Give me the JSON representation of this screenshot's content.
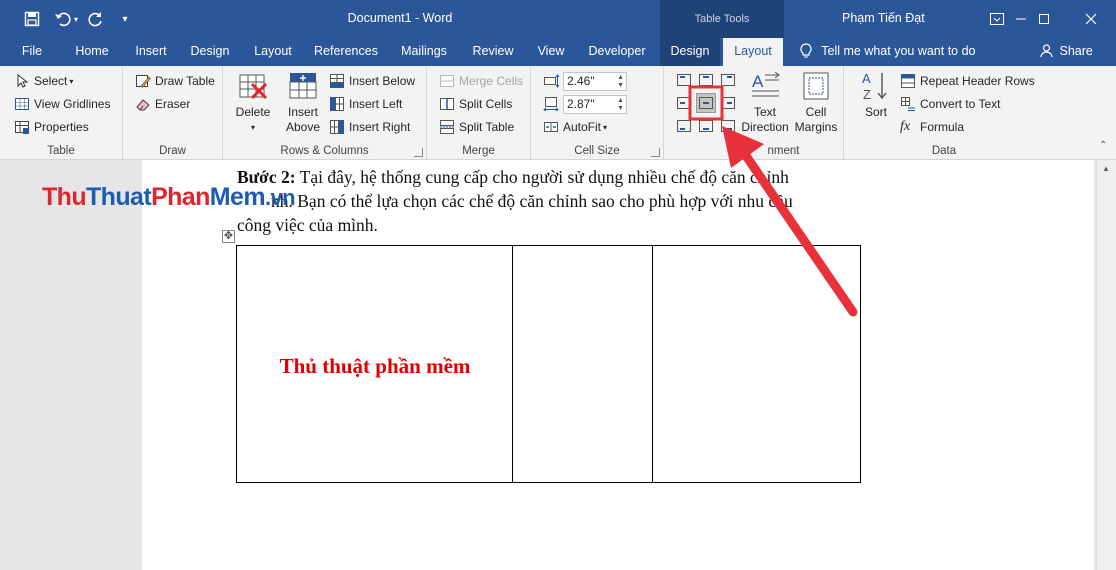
{
  "quick_access": {
    "save_icon": "save-icon",
    "undo_icon": "undo-icon",
    "redo_icon": "redo-icon",
    "customize_icon": "customize-qat-icon"
  },
  "title_bar": {
    "document_title": "Document1 - Word",
    "contextual_label": "Table Tools",
    "user_name": "Phạm Tiến Đạt"
  },
  "tabs": {
    "file": "File",
    "home": "Home",
    "insert": "Insert",
    "design": "Design",
    "layout": "Layout",
    "references": "References",
    "mailings": "Mailings",
    "review": "Review",
    "view": "View",
    "developer": "Developer",
    "table_design": "Design",
    "table_layout": "Layout",
    "tell_me": "Tell me what you want to do",
    "share": "Share"
  },
  "ribbon": {
    "table_group": {
      "label": "Table",
      "select": "Select",
      "view_gridlines": "View Gridlines",
      "properties": "Properties"
    },
    "draw_group": {
      "label": "Draw",
      "draw_table": "Draw Table",
      "eraser": "Eraser"
    },
    "rows_columns_group": {
      "label": "Rows & Columns",
      "delete": "Delete",
      "insert_above_1": "Insert",
      "insert_above_2": "Above",
      "insert_below": "Insert Below",
      "insert_left": "Insert Left",
      "insert_right": "Insert Right"
    },
    "merge_group": {
      "label": "Merge",
      "merge_cells": "Merge Cells",
      "split_cells": "Split Cells",
      "split_table": "Split Table"
    },
    "cell_size_group": {
      "label": "Cell Size",
      "height": "2.46\"",
      "width": "2.87\"",
      "autofit": "AutoFit"
    },
    "alignment_group": {
      "label_visible": "nment",
      "text_direction_1": "Text",
      "text_direction_2": "Direction",
      "cell_margins_1": "Cell",
      "cell_margins_2": "Margins",
      "selected_alignment": "align-center"
    },
    "data_group": {
      "label": "Data",
      "sort": "Sort",
      "repeat_header_rows": "Repeat Header Rows",
      "convert_to_text": "Convert to Text",
      "formula": "Formula"
    }
  },
  "document": {
    "step_label": "Bước 2:",
    "line1": " Tại đây, hệ thống cung cấp cho người sử dụng nhiều chế độ căn chỉnh",
    "line2": "nh. Bạn có thể lựa chọn các chế độ căn chỉnh sao cho phù hợp với nhu cầu",
    "line3": "công việc của mình.",
    "cell_text": "Thủ thuật phần mềm"
  },
  "watermark": {
    "part_red": "Thu",
    "part_blue": "Thuat",
    "part_red2": "Phan",
    "part_blue2": "Mem",
    "tld": ".vn"
  },
  "colors": {
    "title_bar": "#2b579a",
    "contextual_tab": "#1f4277",
    "ribbon": "#f3f3f3",
    "annotation": "#e8313a",
    "cell_text": "#e00000"
  }
}
